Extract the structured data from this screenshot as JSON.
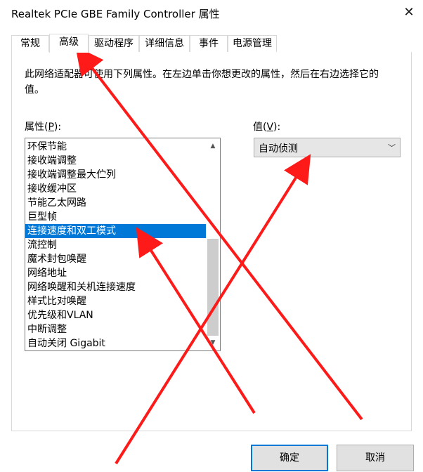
{
  "window": {
    "title": "Realtek PCIe GBE Family Controller 属性",
    "close_glyph": "✕"
  },
  "tabs": [
    {
      "label": "常规"
    },
    {
      "label": "高级"
    },
    {
      "label": "驱动程序"
    },
    {
      "label": "详细信息"
    },
    {
      "label": "事件"
    },
    {
      "label": "电源管理"
    }
  ],
  "advanced": {
    "description": "此网络适配器可使用下列属性。在左边单击你想更改的属性，然后在右边选择它的值。",
    "property_label_prefix": "属性(",
    "property_label_key": "P",
    "property_label_suffix": "):",
    "value_label_prefix": "值(",
    "value_label_key": "V",
    "value_label_suffix": "):",
    "properties": [
      "环保节能",
      "接收端调整",
      "接收端调整最大伫列",
      "接收缓冲区",
      "节能乙太网路",
      "巨型帧",
      "连接速度和双工模式",
      "流控制",
      "魔术封包唤醒",
      "网络地址",
      "网络唤醒和关机连接速度",
      "样式比对唤醒",
      "优先级和VLAN",
      "中断调整",
      "自动关闭 Gigabit"
    ],
    "selected_property": "连接速度和双工模式",
    "value_selected": "自动侦测"
  },
  "buttons": {
    "ok": "确定",
    "cancel": "取消"
  },
  "colors": {
    "selection": "#0078d7",
    "annotation_red": "#ff1a1a"
  }
}
